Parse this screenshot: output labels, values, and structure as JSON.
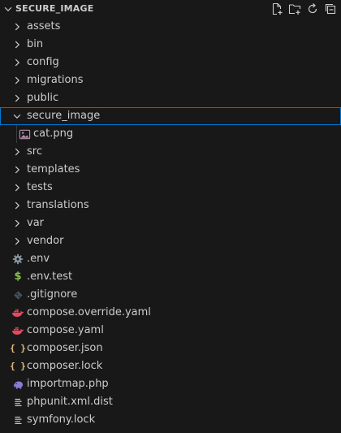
{
  "explorer": {
    "title": "SECURE_IMAGE",
    "actions": [
      "new-file-icon",
      "new-folder-icon",
      "refresh-icon",
      "collapse-all-icon"
    ]
  },
  "tree": {
    "folders_top": [
      {
        "label": "assets"
      },
      {
        "label": "bin"
      },
      {
        "label": "config"
      },
      {
        "label": "migrations"
      },
      {
        "label": "public"
      }
    ],
    "selected_folder": {
      "label": "secure_image"
    },
    "child_file": {
      "label": "cat.png",
      "icon": "image-file-icon"
    },
    "folders_bottom": [
      {
        "label": "src"
      },
      {
        "label": "templates"
      },
      {
        "label": "tests"
      },
      {
        "label": "translations"
      },
      {
        "label": "var"
      },
      {
        "label": "vendor"
      }
    ],
    "files": [
      {
        "label": ".env",
        "icon": "gear-icon"
      },
      {
        "label": ".env.test",
        "icon": "dollar-icon"
      },
      {
        "label": ".gitignore",
        "icon": "git-icon"
      },
      {
        "label": "compose.override.yaml",
        "icon": "docker-icon"
      },
      {
        "label": "compose.yaml",
        "icon": "docker-icon"
      },
      {
        "label": "composer.json",
        "icon": "json-braces-icon"
      },
      {
        "label": "composer.lock",
        "icon": "json-braces-icon"
      },
      {
        "label": "importmap.php",
        "icon": "php-elephant-icon"
      },
      {
        "label": "phpunit.xml.dist",
        "icon": "lines-file-icon"
      },
      {
        "label": "symfony.lock",
        "icon": "lines-file-icon"
      }
    ]
  },
  "colors": {
    "background": "#181818",
    "text": "#cccccc",
    "selection_border": "#0078d4",
    "docker": "#e8475f",
    "json": "#e5c07b",
    "dollar": "#8bc34a",
    "php": "#8c7bd6"
  }
}
